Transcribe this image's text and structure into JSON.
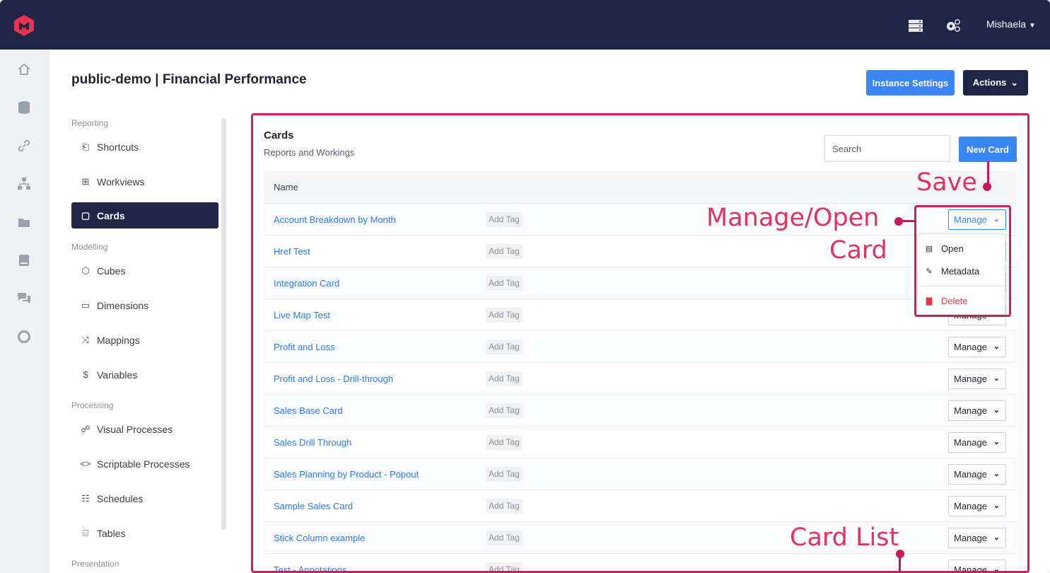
{
  "header": {
    "user_name": "Mishaela",
    "icons": [
      "server-icon",
      "gears-icon"
    ]
  },
  "page": {
    "title": "public-demo | Financial Performance",
    "instance_settings_label": "Instance Settings",
    "actions_label": "Actions"
  },
  "sidebar": {
    "sections": {
      "reporting": "Reporting",
      "modelling": "Modelling",
      "processing": "Processing",
      "presentation": "Presentation"
    },
    "items": [
      {
        "label": "Shortcuts",
        "icon": "shortcut-icon"
      },
      {
        "label": "Workviews",
        "icon": "grid-icon"
      },
      {
        "label": "Cards",
        "icon": "card-icon",
        "active": true
      },
      {
        "label": "Cubes",
        "icon": "cube-icon"
      },
      {
        "label": "Dimensions",
        "icon": "dimension-icon"
      },
      {
        "label": "Mappings",
        "icon": "shuffle-icon"
      },
      {
        "label": "Variables",
        "icon": "dollar-icon"
      },
      {
        "label": "Visual Processes",
        "icon": "flow-icon"
      },
      {
        "label": "Scriptable Processes",
        "icon": "code-icon"
      },
      {
        "label": "Schedules",
        "icon": "calendar-icon"
      },
      {
        "label": "Tables",
        "icon": "database-icon"
      }
    ]
  },
  "cards": {
    "title": "Cards",
    "subtitle": "Reports and Workings",
    "search_placeholder": "Search",
    "new_card_label": "New Card",
    "column_name": "Name",
    "add_tag_label": "Add Tag",
    "manage_label": "Manage",
    "rows": [
      "Account Breakdown by Month",
      "Href Test",
      "Integration Card",
      "Live Map Test",
      "Profit and Loss",
      "Profit and Loss - Drill-through",
      "Sales Base Card",
      "Sales Drill Through",
      "Sales Planning by Product - Popout",
      "Sample Sales Card",
      "Stick Column example",
      "Test - Annotations"
    ]
  },
  "manage_menu": {
    "open": "Open",
    "metadata": "Metadata",
    "delete": "Delete"
  },
  "annotations": {
    "save": "Save",
    "manage_open_card_line1": "Manage/Open",
    "manage_open_card_line2": "Card",
    "card_list": "Card List"
  },
  "colors": {
    "navy": "#1e2547",
    "accent_blue": "#3b86f5",
    "link_blue": "#2d7be8",
    "annotation": "#d01d5e",
    "danger": "#e53945"
  }
}
